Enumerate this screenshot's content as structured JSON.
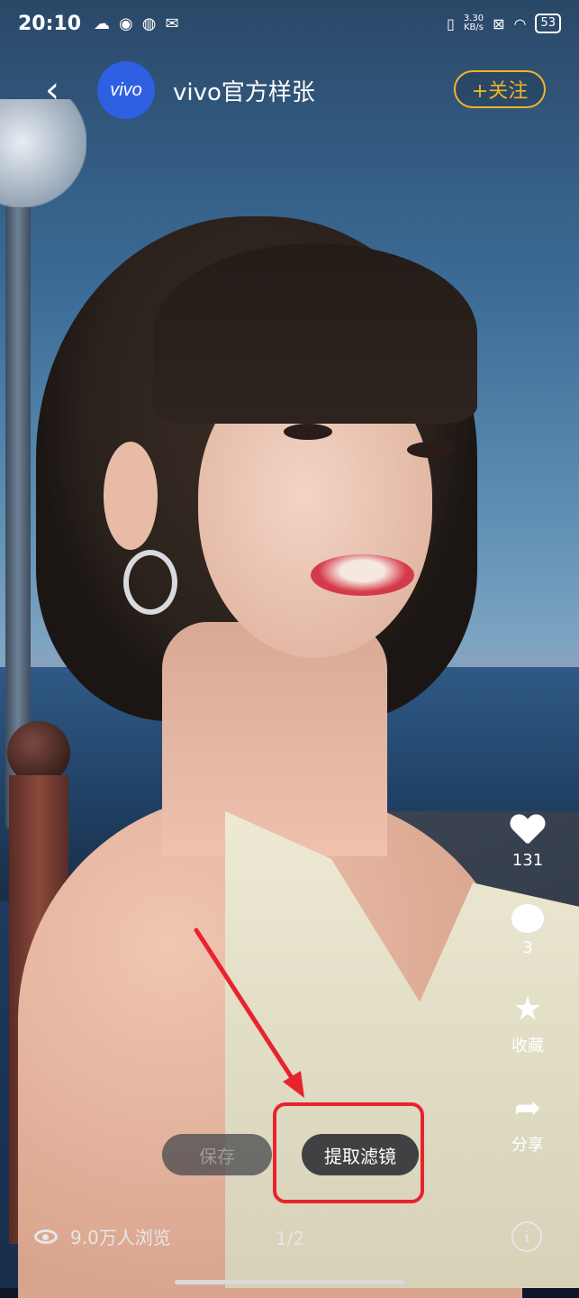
{
  "status_bar": {
    "time": "20:10",
    "net_speed_value": "3.30",
    "net_speed_unit": "KB/s",
    "battery": "53"
  },
  "header": {
    "avatar_text": "vivo",
    "account_name": "vivo官方样张",
    "follow_label": "+关注"
  },
  "actions": {
    "like_count": "131",
    "comment_count": "3",
    "collect_label": "收藏",
    "share_label": "分享"
  },
  "bottom": {
    "save_label": "保存",
    "extract_filter_label": "提取滤镜",
    "views_text": "9.0万人浏览",
    "pager": "1/2",
    "info_glyph": "i"
  },
  "icons": {
    "back": "chevron-left-icon",
    "like": "heart-icon",
    "comment": "comment-bubble-icon",
    "collect": "star-icon",
    "share": "share-arrow-icon",
    "views": "eye-icon",
    "info": "info-icon"
  },
  "colors": {
    "follow_accent": "#f0b429",
    "avatar_bg": "#2f5fe2",
    "highlight_red": "#e8232f"
  }
}
